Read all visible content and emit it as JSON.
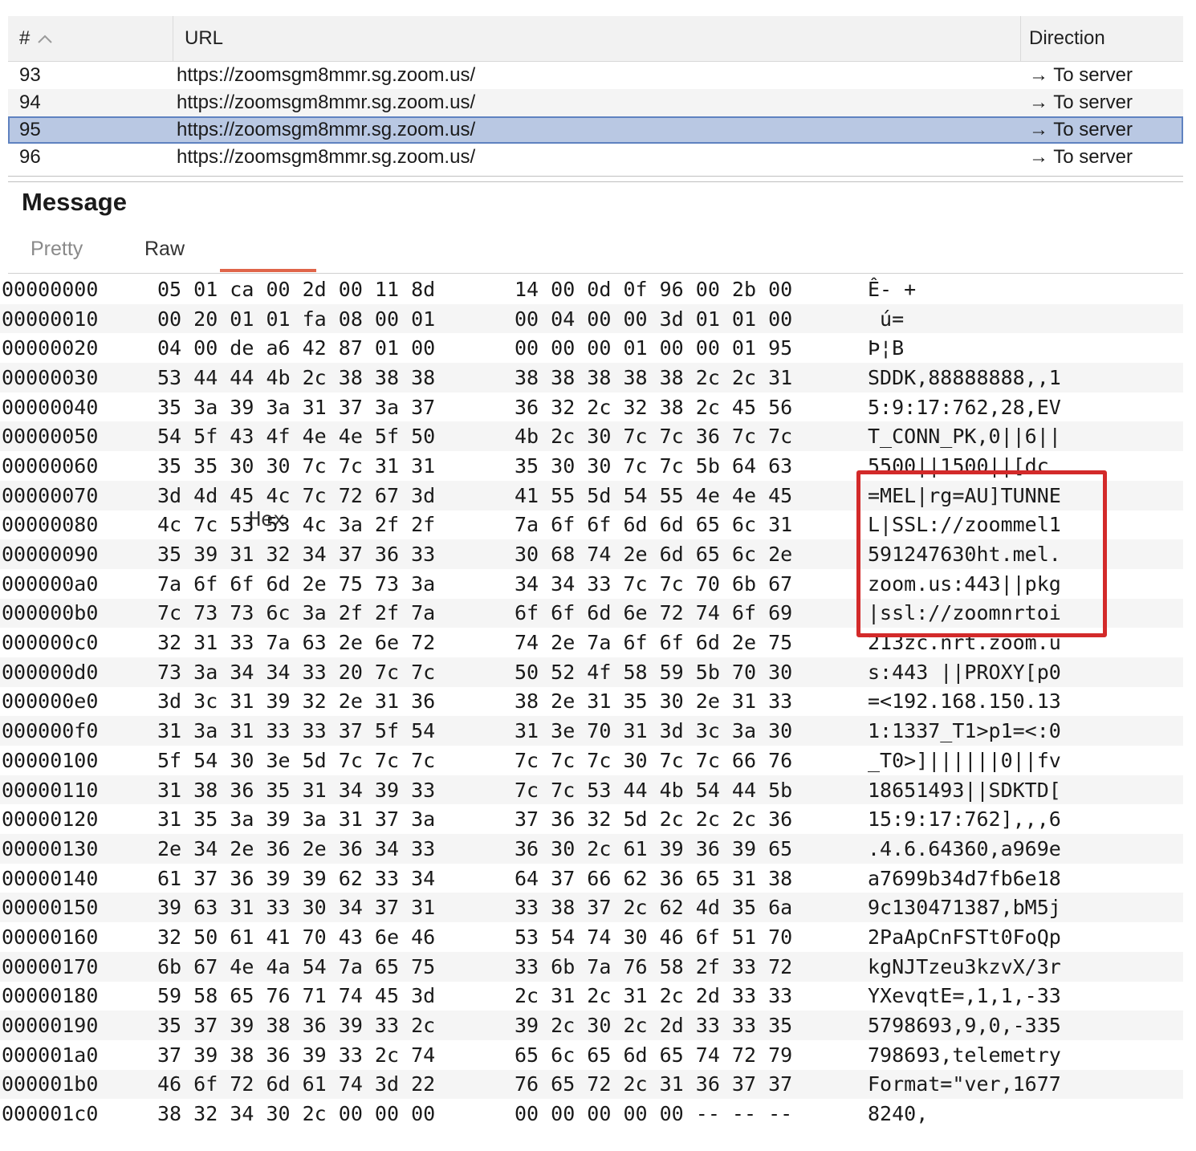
{
  "table": {
    "headers": {
      "num": "#",
      "url": "URL",
      "direction": "Direction"
    },
    "rows": [
      {
        "num": "93",
        "url": "https://zoomsgm8mmr.sg.zoom.us/",
        "direction": "→ To server"
      },
      {
        "num": "94",
        "url": "https://zoomsgm8mmr.sg.zoom.us/",
        "direction": "→ To server"
      },
      {
        "num": "95",
        "url": "https://zoomsgm8mmr.sg.zoom.us/",
        "direction": "→ To server",
        "selected": true
      },
      {
        "num": "96",
        "url": "https://zoomsgm8mmr.sg.zoom.us/",
        "direction": "→ To server"
      }
    ]
  },
  "message": {
    "title": "Message",
    "tabs": {
      "pretty": "Pretty",
      "raw": "Raw",
      "hex": "Hex"
    },
    "active_tab": "Hex"
  },
  "hex": {
    "rows": [
      {
        "offset": "00000000",
        "bytes1": "05 01 ca 00 2d 00 11 8d",
        "bytes2": "14 00 0d 0f 96 00 2b 00",
        "ascii": "Ê- +"
      },
      {
        "offset": "00000010",
        "bytes1": "00 20 01 01 fa 08 00 01",
        "bytes2": "00 04 00 00 3d 01 01 00",
        "ascii": " ú="
      },
      {
        "offset": "00000020",
        "bytes1": "04 00 de a6 42 87 01 00",
        "bytes2": "00 00 00 01 00 00 01 95",
        "ascii": "Þ¦B"
      },
      {
        "offset": "00000030",
        "bytes1": "53 44 44 4b 2c 38 38 38",
        "bytes2": "38 38 38 38 38 2c 2c 31",
        "ascii": "SDDK,88888888,,1"
      },
      {
        "offset": "00000040",
        "bytes1": "35 3a 39 3a 31 37 3a 37",
        "bytes2": "36 32 2c 32 38 2c 45 56",
        "ascii": "5:9:17:762,28,EV"
      },
      {
        "offset": "00000050",
        "bytes1": "54 5f 43 4f 4e 4e 5f 50",
        "bytes2": "4b 2c 30 7c 7c 36 7c 7c",
        "ascii": "T_CONN_PK,0||6||"
      },
      {
        "offset": "00000060",
        "bytes1": "35 35 30 30 7c 7c 31 31",
        "bytes2": "35 30 30 7c 7c 5b 64 63",
        "ascii": "5500||1500||[dc"
      },
      {
        "offset": "00000070",
        "bytes1": "3d 4d 45 4c 7c 72 67 3d",
        "bytes2": "41 55 5d 54 55 4e 4e 45",
        "ascii": "=MEL|rg=AU]TUNNE"
      },
      {
        "offset": "00000080",
        "bytes1": "4c 7c 53 53 4c 3a 2f 2f",
        "bytes2": "7a 6f 6f 6d 6d 65 6c 31",
        "ascii": "L|SSL://zoommel1"
      },
      {
        "offset": "00000090",
        "bytes1": "35 39 31 32 34 37 36 33",
        "bytes2": "30 68 74 2e 6d 65 6c 2e",
        "ascii": "591247630ht.mel."
      },
      {
        "offset": "000000a0",
        "bytes1": "7a 6f 6f 6d 2e 75 73 3a",
        "bytes2": "34 34 33 7c 7c 70 6b 67",
        "ascii": "zoom.us:443||pkg"
      },
      {
        "offset": "000000b0",
        "bytes1": "7c 73 73 6c 3a 2f 2f 7a",
        "bytes2": "6f 6f 6d 6e 72 74 6f 69",
        "ascii": "|ssl://zoomnrtoi"
      },
      {
        "offset": "000000c0",
        "bytes1": "32 31 33 7a 63 2e 6e 72",
        "bytes2": "74 2e 7a 6f 6f 6d 2e 75",
        "ascii": "213zc.nrt.zoom.u"
      },
      {
        "offset": "000000d0",
        "bytes1": "73 3a 34 34 33 20 7c 7c",
        "bytes2": "50 52 4f 58 59 5b 70 30",
        "ascii": "s:443 ||PROXY[p0"
      },
      {
        "offset": "000000e0",
        "bytes1": "3d 3c 31 39 32 2e 31 36",
        "bytes2": "38 2e 31 35 30 2e 31 33",
        "ascii": "=<192.168.150.13"
      },
      {
        "offset": "000000f0",
        "bytes1": "31 3a 31 33 33 37 5f 54",
        "bytes2": "31 3e 70 31 3d 3c 3a 30",
        "ascii": "1:1337_T1>p1=<:0"
      },
      {
        "offset": "00000100",
        "bytes1": "5f 54 30 3e 5d 7c 7c 7c",
        "bytes2": "7c 7c 7c 30 7c 7c 66 76",
        "ascii": "_T0>]||||||0||fv"
      },
      {
        "offset": "00000110",
        "bytes1": "31 38 36 35 31 34 39 33",
        "bytes2": "7c 7c 53 44 4b 54 44 5b",
        "ascii": "18651493||SDKTD["
      },
      {
        "offset": "00000120",
        "bytes1": "31 35 3a 39 3a 31 37 3a",
        "bytes2": "37 36 32 5d 2c 2c 2c 36",
        "ascii": "15:9:17:762],,,6"
      },
      {
        "offset": "00000130",
        "bytes1": "2e 34 2e 36 2e 36 34 33",
        "bytes2": "36 30 2c 61 39 36 39 65",
        "ascii": ".4.6.64360,a969e"
      },
      {
        "offset": "00000140",
        "bytes1": "61 37 36 39 39 62 33 34",
        "bytes2": "64 37 66 62 36 65 31 38",
        "ascii": "a7699b34d7fb6e18"
      },
      {
        "offset": "00000150",
        "bytes1": "39 63 31 33 30 34 37 31",
        "bytes2": "33 38 37 2c 62 4d 35 6a",
        "ascii": "9c130471387,bM5j"
      },
      {
        "offset": "00000160",
        "bytes1": "32 50 61 41 70 43 6e 46",
        "bytes2": "53 54 74 30 46 6f 51 70",
        "ascii": "2PaApCnFSTt0FoQp"
      },
      {
        "offset": "00000170",
        "bytes1": "6b 67 4e 4a 54 7a 65 75",
        "bytes2": "33 6b 7a 76 58 2f 33 72",
        "ascii": "kgNJTzeu3kzvX/3r"
      },
      {
        "offset": "00000180",
        "bytes1": "59 58 65 76 71 74 45 3d",
        "bytes2": "2c 31 2c 31 2c 2d 33 33",
        "ascii": "YXevqtE=,1,1,-33"
      },
      {
        "offset": "00000190",
        "bytes1": "35 37 39 38 36 39 33 2c",
        "bytes2": "39 2c 30 2c 2d 33 33 35",
        "ascii": "5798693,9,0,-335"
      },
      {
        "offset": "000001a0",
        "bytes1": "37 39 38 36 39 33 2c 74",
        "bytes2": "65 6c 65 6d 65 74 72 79",
        "ascii": "798693,telemetry"
      },
      {
        "offset": "000001b0",
        "bytes1": "46 6f 72 6d 61 74 3d 22",
        "bytes2": "76 65 72 2c 31 36 37 37",
        "ascii": "Format=\"ver,1677"
      },
      {
        "offset": "000001c0",
        "bytes1": "38 32 34 30 2c 00 00 00",
        "bytes2": "00 00 00 00 00 -- -- --",
        "ascii": "8240,"
      }
    ]
  },
  "colors": {
    "selection": "#b9c8e3",
    "selection_border": "#5f82c0",
    "highlight": "#d32a2a",
    "tab_underline": "#e0654a"
  }
}
